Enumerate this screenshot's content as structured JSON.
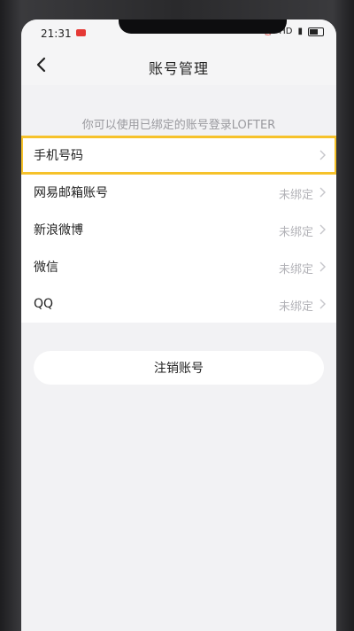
{
  "status": {
    "time": "21:31",
    "right_label": "HD"
  },
  "nav": {
    "title": "账号管理"
  },
  "hint": "你可以使用已绑定的账号登录LOFTER",
  "groups": {
    "primary": [
      {
        "label": "手机号码",
        "value": ""
      },
      {
        "label": "网易邮箱账号",
        "value": "未绑定"
      }
    ],
    "social": [
      {
        "label": "新浪微博",
        "value": "未绑定"
      },
      {
        "label": "微信",
        "value": "未绑定"
      },
      {
        "label": "QQ",
        "value": "未绑定"
      }
    ]
  },
  "actions": {
    "cancel_account": "注销账号"
  },
  "colors": {
    "highlight": "#f6c22a",
    "background": "#f2f2f4"
  }
}
